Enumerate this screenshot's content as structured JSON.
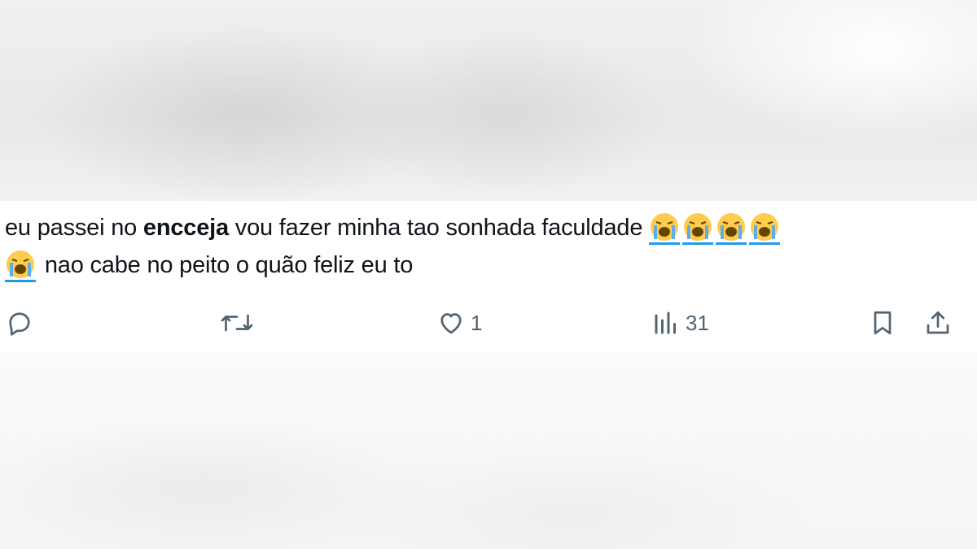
{
  "tweet": {
    "text_line1_pre": "eu passei no ",
    "text_bold": "encceja",
    "text_line1_post": " vou fazer minha tao sonhada faculdade",
    "text_line2": " nao cabe no peito o quão feliz eu to",
    "emoji_name": "loudly-crying-face-icon",
    "emoji_count": 5
  },
  "actions": {
    "reply_icon": "reply-icon",
    "retweet_icon": "retweet-icon",
    "like_icon": "heart-icon",
    "like_count": "1",
    "views_icon": "views-icon",
    "views_count": "31",
    "bookmark_icon": "bookmark-icon",
    "share_icon": "share-icon"
  },
  "colors": {
    "text": "#0f1419",
    "muted": "#536471",
    "link_underline": "#1d9bf0",
    "emoji_face": "#ffcc4d"
  }
}
